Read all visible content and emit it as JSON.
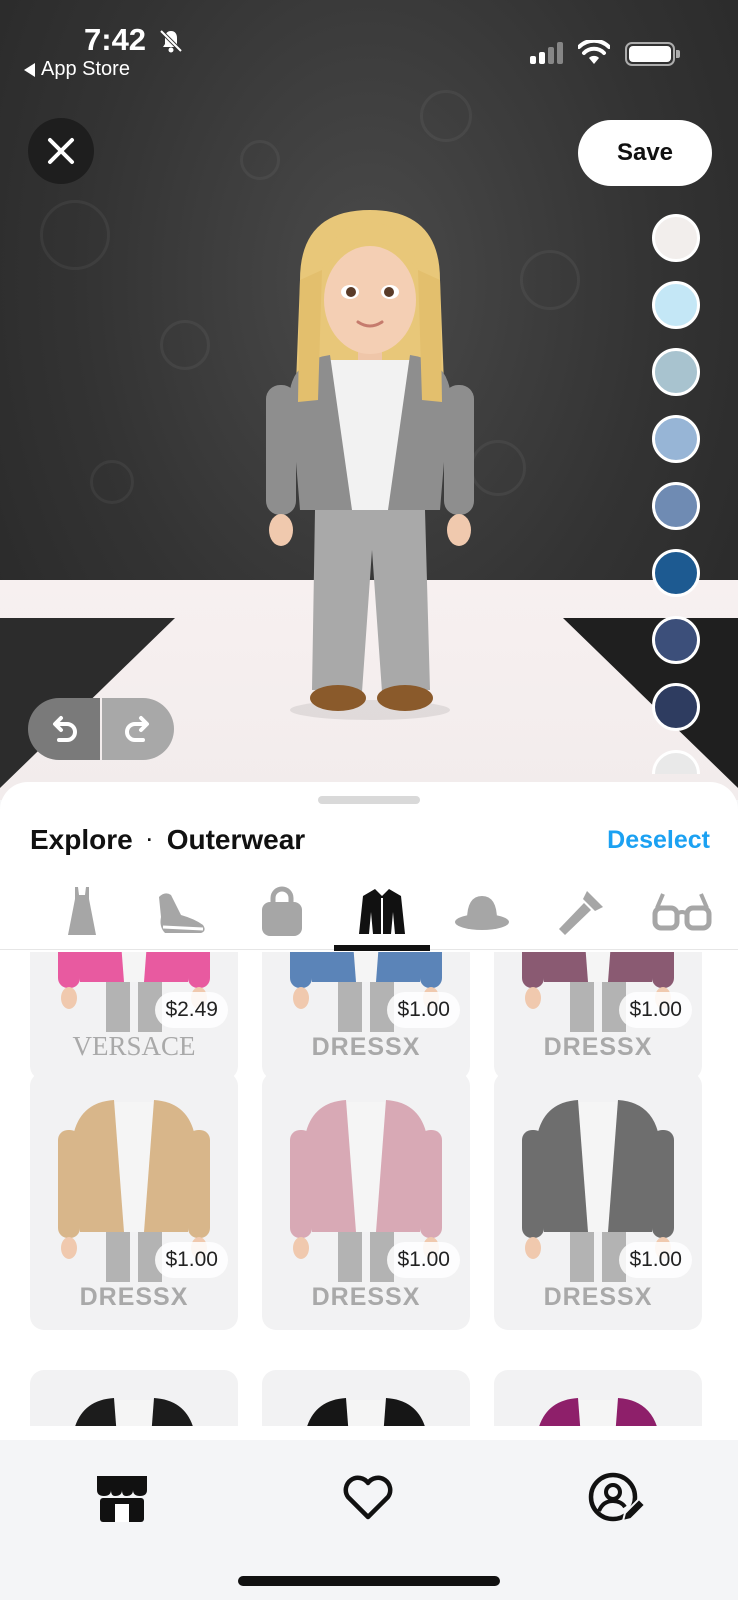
{
  "status_bar": {
    "time": "7:42",
    "back_label": "App Store",
    "icons": [
      "bell-slash-icon",
      "cellular-signal-icon",
      "wifi-icon",
      "battery-icon"
    ]
  },
  "header": {
    "close_icon": "close-icon",
    "save_label": "Save"
  },
  "color_swatches": [
    "#f2eeec",
    "#c4e7f6",
    "#a8c3cf",
    "#97b5d6",
    "#6f8bb3",
    "#1d5a91",
    "#3c4f7a",
    "#2e3c60"
  ],
  "history": {
    "undo_icon": "undo-icon",
    "redo_icon": "redo-icon"
  },
  "sheet": {
    "breadcrumb_root": "Explore",
    "breadcrumb_separator": "·",
    "breadcrumb_current": "Outerwear",
    "deselect_label": "Deselect",
    "category_tabs": [
      {
        "icon": "dress-icon",
        "active": false
      },
      {
        "icon": "sneaker-icon",
        "active": false
      },
      {
        "icon": "bag-icon",
        "active": false
      },
      {
        "icon": "jacket-icon",
        "active": true
      },
      {
        "icon": "hat-icon",
        "active": false
      },
      {
        "icon": "makeup-brush-icon",
        "active": false
      },
      {
        "icon": "glasses-icon",
        "active": false
      }
    ]
  },
  "products": [
    {
      "price": "$2.49",
      "brand": "VERSACE",
      "color": "#e85aa0"
    },
    {
      "price": "$1.00",
      "brand": "DRESSX",
      "color": "#5b84b8"
    },
    {
      "price": "$1.00",
      "brand": "DRESSX",
      "color": "#8a5a72"
    },
    {
      "price": "$1.00",
      "brand": "DRESSX",
      "color": "#d8b68a"
    },
    {
      "price": "$1.00",
      "brand": "DRESSX",
      "color": "#d8a9b5"
    },
    {
      "price": "$1.00",
      "brand": "DRESSX",
      "color": "#6e6e6e"
    },
    {
      "color": "#1c1c1c"
    },
    {
      "color": "#161616"
    },
    {
      "color": "#8e1f6a"
    }
  ],
  "bottom_nav": [
    {
      "icon": "shop-icon"
    },
    {
      "icon": "heart-icon"
    },
    {
      "icon": "edit-avatar-icon"
    }
  ]
}
